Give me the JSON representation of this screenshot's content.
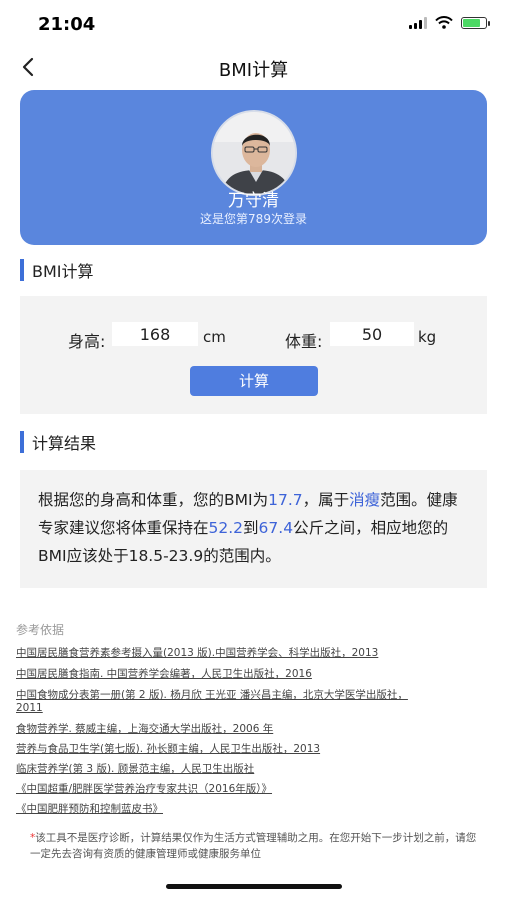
{
  "status_bar": {
    "time": "21:04",
    "battery_level_percent": 80,
    "battery_color": "#4cd964"
  },
  "nav": {
    "back_icon": "chevron-left-icon",
    "title": "BMI计算"
  },
  "profile": {
    "name": "万守清",
    "login_text": "这是您第789次登录",
    "card_color": "#5a86dd"
  },
  "bmi_section": {
    "title": "BMI计算",
    "height_label": "身高:",
    "height_value": "168",
    "height_unit": "cm",
    "weight_label": "体重:",
    "weight_value": "50",
    "weight_unit": "kg",
    "button_label": "计算",
    "button_color": "#4f7ddf"
  },
  "result_section": {
    "title": "计算结果",
    "text_1": "根据您的身高和体重，您的BMI为",
    "bmi": "17.7",
    "text_2": "，属于",
    "category": "消瘦",
    "text_3": "范围。健康专家建议您将体重保持在",
    "weight_min": "52.2",
    "text_4": "到",
    "weight_max": "67.4",
    "text_5": "公斤之间，相应地您的BMI应该处于18.5-23.9的范围内。",
    "highlight_color": "#3d63d8"
  },
  "references": {
    "title": "参考依据",
    "items": [
      "中国居民膳食营养素参考摄入量(2013 版).中国营养学会、科学出版社，2013",
      "中国居民膳食指南. 中国营养学会编著，人民卫生出版社，2016",
      "中国食物成分表第一册(第 2 版). 杨月欣 王光亚 潘兴昌主编，北京大学医学出版社，",
      "2011",
      "食物营养学. 蔡威主编，上海交通大学出版社，2006 年",
      "营养与食品卫生学(第七版). 孙长颢主编，人民卫生出版社，2013",
      "临床营养学(第 3 版). 顾景范主编，人民卫生出版社",
      "《中国超重/肥胖医学营养治疗专家共识（2016年版）》",
      "《中国肥胖预防和控制蓝皮书》"
    ]
  },
  "disclaimer": {
    "star": "*",
    "text": "该工具不是医疗诊断，计算结果仅作为生活方式管理辅助之用。在您开始下一步计划之前，请您一定先去咨询有资质的健康管理师或健康服务单位"
  }
}
